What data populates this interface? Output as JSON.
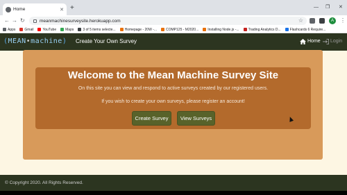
{
  "browser": {
    "tab_title": "Home",
    "url": "meanmachinesurveysite.herokuapp.com",
    "avatar_letter": "A",
    "bookmarks": [
      {
        "label": "Apps",
        "color": "#5f6368"
      },
      {
        "label": "Gmail",
        "color": "#d93025"
      },
      {
        "label": "YouTube",
        "color": "#ff0000"
      },
      {
        "label": "Maps",
        "color": "#34a853"
      },
      {
        "label": "3 of 5 items selecte...",
        "color": "#3c4043"
      },
      {
        "label": "Homepage - 20W -...",
        "color": "#e8710a"
      },
      {
        "label": "COMP125 - M2020...",
        "color": "#e8710a"
      },
      {
        "label": "Installing Node.js -...",
        "color": "#e8710a"
      },
      {
        "label": "Trading Analytics D...",
        "color": "#c5221f"
      },
      {
        "label": "Flashcards 6 Require...",
        "color": "#1a73e8"
      }
    ]
  },
  "navbar": {
    "logo_left": "(",
    "logo_name": "MEAN",
    "logo_right": "machine",
    "logo_close": ")",
    "subtitle": "Create Your Own Survey",
    "home": "Home",
    "login": "Login"
  },
  "hero": {
    "title": "Welcome to the Mean Machine Survey Site",
    "line1": "On this site you can view and respond to active surveys created by our registered users.",
    "line2": "If you wish to create your own surveys, please register an account!",
    "create_btn": "Create Survey",
    "view_btn": "View Surveys"
  },
  "footer": {
    "copyright": "© Copyright 2020. All Rights Reserved."
  },
  "colors": {
    "navbar": "#2c3520",
    "outer_card": "#d89a5a",
    "inner_card": "#b36a2c",
    "button": "#58622a",
    "page_bg": "#fdf6e3"
  }
}
